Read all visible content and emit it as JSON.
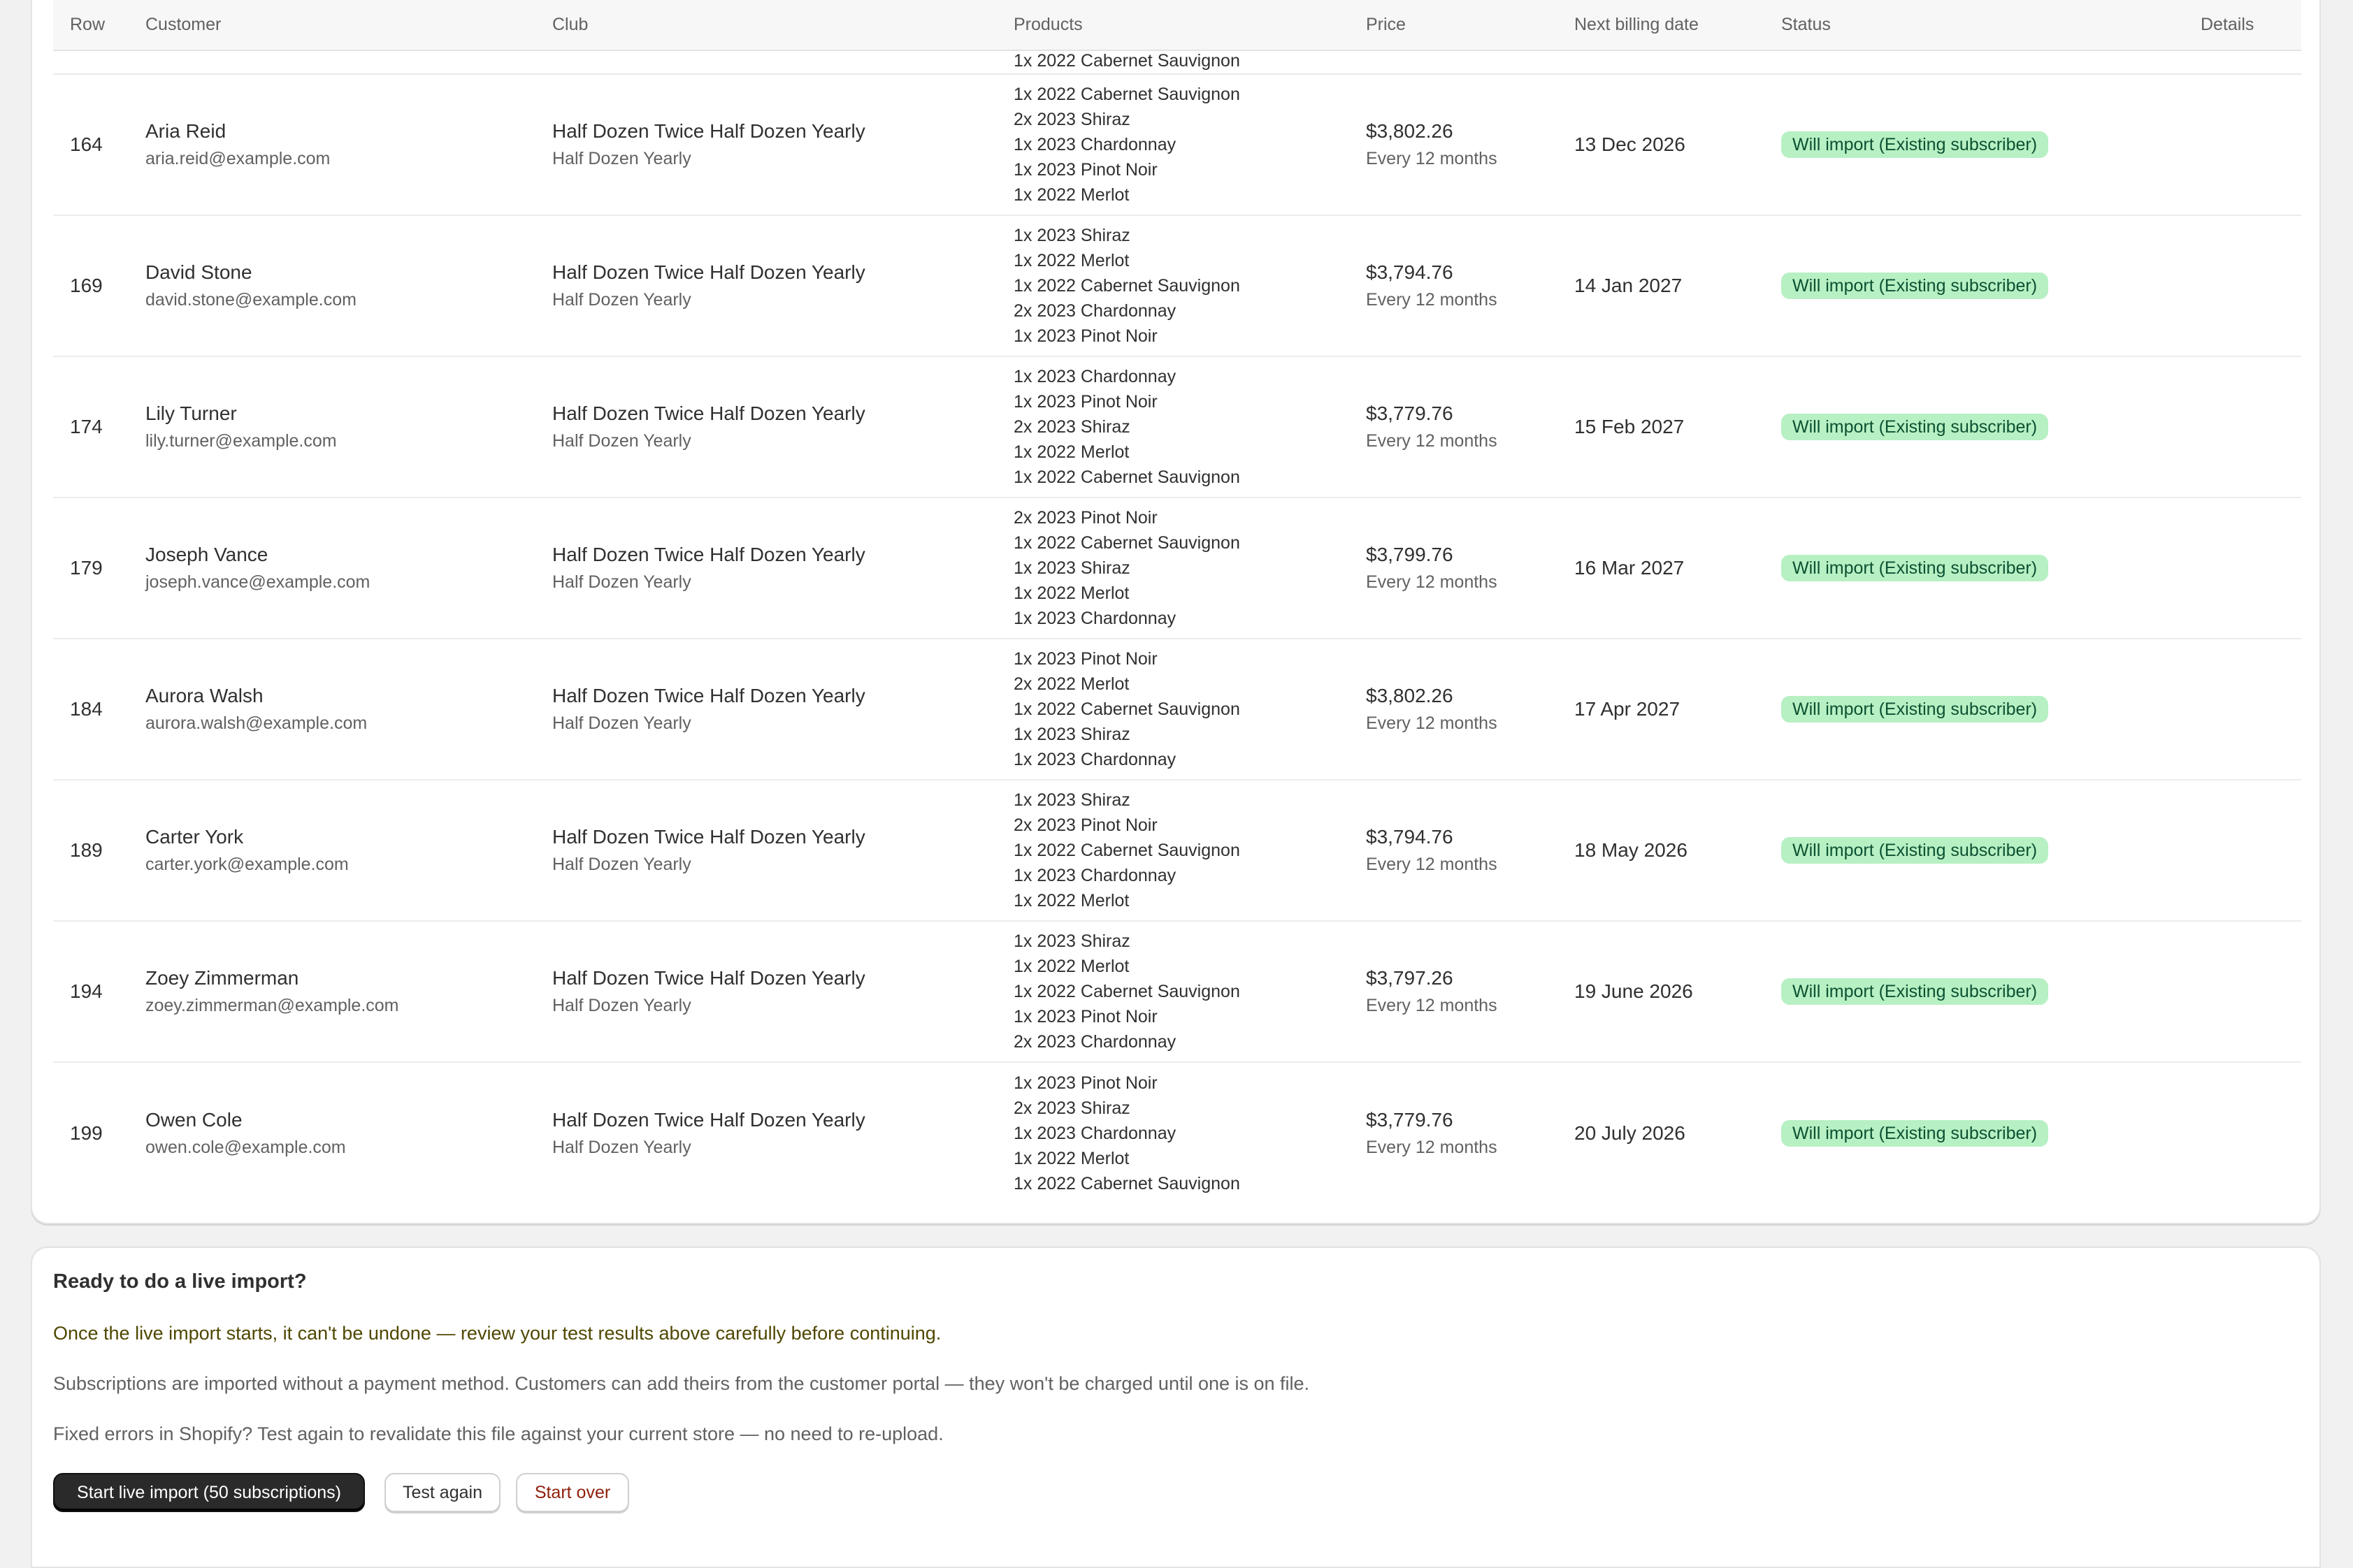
{
  "table": {
    "headers": [
      "Row",
      "Customer",
      "Club",
      "Products",
      "Price",
      "Next billing date",
      "Status",
      "Details"
    ],
    "partial_row_product": "1x 2022 Cabernet Sauvignon",
    "rows": [
      {
        "row": "164",
        "name": "Aria Reid",
        "email": "aria.reid@example.com",
        "club": "Half Dozen Twice Half Dozen Yearly",
        "club_sub": "Half Dozen Yearly",
        "products": [
          "1x 2022 Cabernet Sauvignon",
          "2x 2023 Shiraz",
          "1x 2023 Chardonnay",
          "1x 2023 Pinot Noir",
          "1x 2022 Merlot"
        ],
        "price": "$3,802.26",
        "interval": "Every 12 months",
        "date": "13 Dec 2026",
        "status": "Will import (Existing subscriber)"
      },
      {
        "row": "169",
        "name": "David Stone",
        "email": "david.stone@example.com",
        "club": "Half Dozen Twice Half Dozen Yearly",
        "club_sub": "Half Dozen Yearly",
        "products": [
          "1x 2023 Shiraz",
          "1x 2022 Merlot",
          "1x 2022 Cabernet Sauvignon",
          "2x 2023 Chardonnay",
          "1x 2023 Pinot Noir"
        ],
        "price": "$3,794.76",
        "interval": "Every 12 months",
        "date": "14 Jan 2027",
        "status": "Will import (Existing subscriber)"
      },
      {
        "row": "174",
        "name": "Lily Turner",
        "email": "lily.turner@example.com",
        "club": "Half Dozen Twice Half Dozen Yearly",
        "club_sub": "Half Dozen Yearly",
        "products": [
          "1x 2023 Chardonnay",
          "1x 2023 Pinot Noir",
          "2x 2023 Shiraz",
          "1x 2022 Merlot",
          "1x 2022 Cabernet Sauvignon"
        ],
        "price": "$3,779.76",
        "interval": "Every 12 months",
        "date": "15 Feb 2027",
        "status": "Will import (Existing subscriber)"
      },
      {
        "row": "179",
        "name": "Joseph Vance",
        "email": "joseph.vance@example.com",
        "club": "Half Dozen Twice Half Dozen Yearly",
        "club_sub": "Half Dozen Yearly",
        "products": [
          "2x 2023 Pinot Noir",
          "1x 2022 Cabernet Sauvignon",
          "1x 2023 Shiraz",
          "1x 2022 Merlot",
          "1x 2023 Chardonnay"
        ],
        "price": "$3,799.76",
        "interval": "Every 12 months",
        "date": "16 Mar 2027",
        "status": "Will import (Existing subscriber)"
      },
      {
        "row": "184",
        "name": "Aurora Walsh",
        "email": "aurora.walsh@example.com",
        "club": "Half Dozen Twice Half Dozen Yearly",
        "club_sub": "Half Dozen Yearly",
        "products": [
          "1x 2023 Pinot Noir",
          "2x 2022 Merlot",
          "1x 2022 Cabernet Sauvignon",
          "1x 2023 Shiraz",
          "1x 2023 Chardonnay"
        ],
        "price": "$3,802.26",
        "interval": "Every 12 months",
        "date": "17 Apr 2027",
        "status": "Will import (Existing subscriber)"
      },
      {
        "row": "189",
        "name": "Carter York",
        "email": "carter.york@example.com",
        "club": "Half Dozen Twice Half Dozen Yearly",
        "club_sub": "Half Dozen Yearly",
        "products": [
          "1x 2023 Shiraz",
          "2x 2023 Pinot Noir",
          "1x 2022 Cabernet Sauvignon",
          "1x 2023 Chardonnay",
          "1x 2022 Merlot"
        ],
        "price": "$3,794.76",
        "interval": "Every 12 months",
        "date": "18 May 2026",
        "status": "Will import (Existing subscriber)"
      },
      {
        "row": "194",
        "name": "Zoey Zimmerman",
        "email": "zoey.zimmerman@example.com",
        "club": "Half Dozen Twice Half Dozen Yearly",
        "club_sub": "Half Dozen Yearly",
        "products": [
          "1x 2023 Shiraz",
          "1x 2022 Merlot",
          "1x 2022 Cabernet Sauvignon",
          "1x 2023 Pinot Noir",
          "2x 2023 Chardonnay"
        ],
        "price": "$3,797.26",
        "interval": "Every 12 months",
        "date": "19 June 2026",
        "status": "Will import (Existing subscriber)"
      },
      {
        "row": "199",
        "name": "Owen Cole",
        "email": "owen.cole@example.com",
        "club": "Half Dozen Twice Half Dozen Yearly",
        "club_sub": "Half Dozen Yearly",
        "products": [
          "1x 2023 Pinot Noir",
          "2x 2023 Shiraz",
          "1x 2023 Chardonnay",
          "1x 2022 Merlot",
          "1x 2022 Cabernet Sauvignon"
        ],
        "price": "$3,779.76",
        "interval": "Every 12 months",
        "date": "20 July 2026",
        "status": "Will import (Existing subscriber)"
      }
    ]
  },
  "import_panel": {
    "title": "Ready to do a live import?",
    "warning": "Once the live import starts, it can't be undone — review your test results above carefully before continuing.",
    "info": "Subscriptions are imported without a payment method. Customers can add theirs from the customer portal — they won't be charged until one is on file.",
    "retest": "Fixed errors in Shopify? Test again to revalidate this file against your current store — no need to re-upload.",
    "start_label": "Start live import (50 subscriptions)",
    "test_label": "Test again",
    "startover_label": "Start over"
  },
  "colors": {
    "status_badge_bg": "#b7f0c3",
    "status_badge_text": "#0c5132",
    "warning_text": "#4f4700",
    "danger_text": "#8e1f0b",
    "primary_button": "#2a2a2a"
  }
}
